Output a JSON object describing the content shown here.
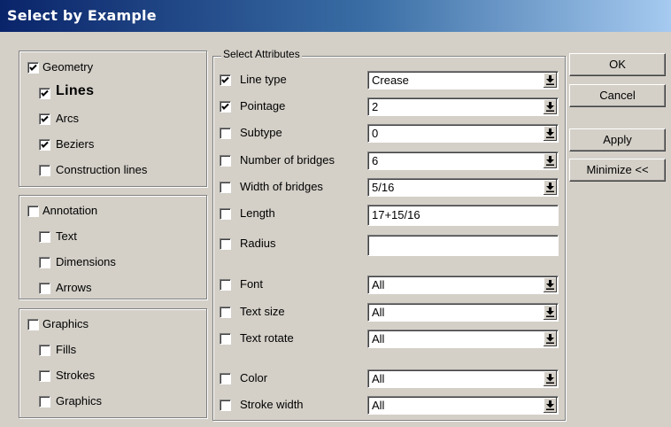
{
  "window": {
    "title": "Select by Example"
  },
  "left_panel": {
    "geometry": {
      "label": "Geometry",
      "checked": true,
      "items": [
        {
          "label": "Lines",
          "checked": true
        },
        {
          "label": "Arcs",
          "checked": true
        },
        {
          "label": "Beziers",
          "checked": true
        },
        {
          "label": "Construction lines",
          "checked": false
        }
      ]
    },
    "annotation": {
      "label": "Annotation",
      "checked": false,
      "items": [
        {
          "label": "Text",
          "checked": false
        },
        {
          "label": "Dimensions",
          "checked": false
        },
        {
          "label": "Arrows",
          "checked": false
        }
      ]
    },
    "graphics": {
      "label": "Graphics",
      "checked": false,
      "items": [
        {
          "label": "Fills",
          "checked": false
        },
        {
          "label": "Strokes",
          "checked": false
        },
        {
          "label": "Graphics",
          "checked": false
        }
      ]
    }
  },
  "select_attributes": {
    "legend": "Select Attributes",
    "rows": [
      {
        "label": "Line type",
        "checked": true,
        "value": "Crease",
        "control": "combo"
      },
      {
        "label": "Pointage",
        "checked": true,
        "value": "2",
        "control": "combo"
      },
      {
        "label": "Subtype",
        "checked": false,
        "value": "0",
        "control": "combo"
      },
      {
        "label": "Number of bridges",
        "checked": false,
        "value": "6",
        "control": "combo"
      },
      {
        "label": "Width of bridges",
        "checked": false,
        "value": "5/16",
        "control": "combo"
      },
      {
        "label": "Length",
        "checked": false,
        "value": "17+15/16",
        "control": "field"
      },
      {
        "label": "Radius",
        "checked": false,
        "value": "",
        "control": "field"
      },
      {
        "label": "Font",
        "checked": false,
        "value": "All",
        "control": "combo"
      },
      {
        "label": "Text size",
        "checked": false,
        "value": "All",
        "control": "combo"
      },
      {
        "label": "Text rotate",
        "checked": false,
        "value": "All",
        "control": "combo"
      },
      {
        "label": "Color",
        "checked": false,
        "value": "All",
        "control": "combo"
      },
      {
        "label": "Stroke width",
        "checked": false,
        "value": "All",
        "control": "combo"
      }
    ]
  },
  "buttons": {
    "ok": "OK",
    "cancel": "Cancel",
    "apply": "Apply",
    "minimize": "Minimize <<"
  },
  "colors": {
    "titlebar_start": "#0a246a",
    "titlebar_end": "#a6caf0",
    "face": "#d4d0c8"
  }
}
